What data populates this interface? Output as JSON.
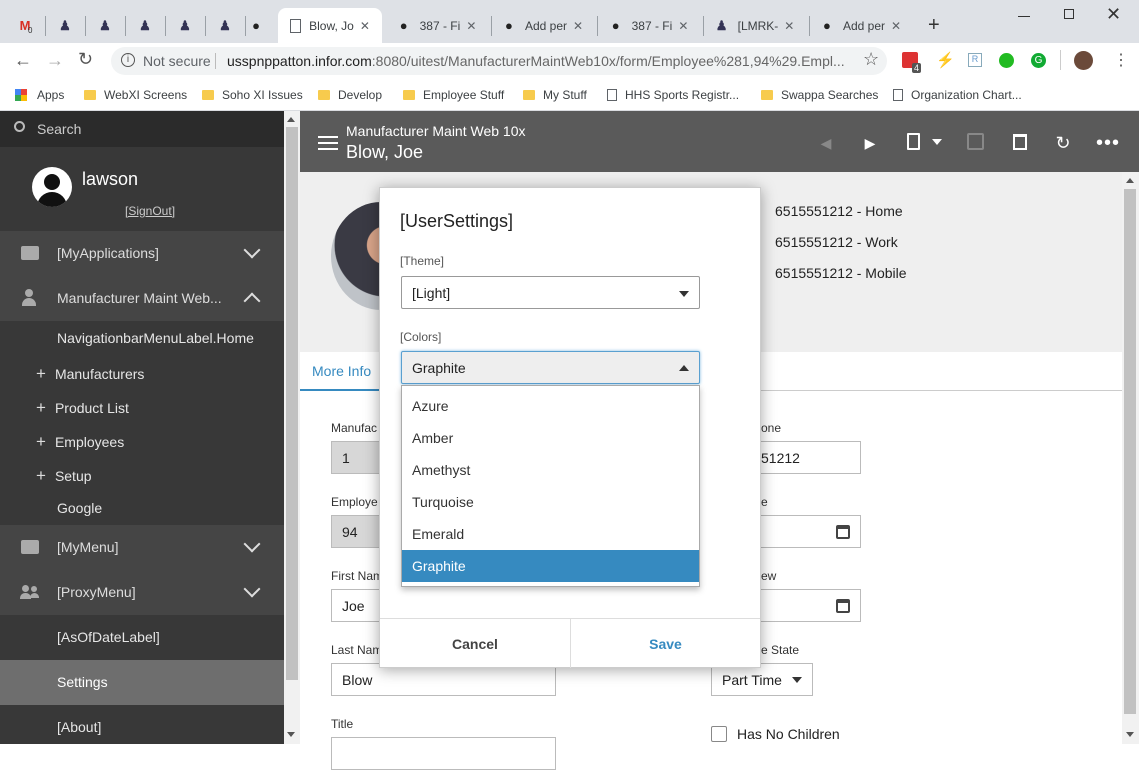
{
  "browser": {
    "tabs": [
      {
        "title": "",
        "icon": "gmail-icon",
        "badge": "0"
      },
      {
        "title": "",
        "icon": "jenkins-icon"
      },
      {
        "title": "",
        "icon": "jenkins-icon"
      },
      {
        "title": "",
        "icon": "jenkins-icon"
      },
      {
        "title": "",
        "icon": "jenkins-icon"
      },
      {
        "title": "",
        "icon": "jenkins-icon"
      },
      {
        "title": "",
        "icon": "github-icon"
      },
      {
        "title": "Blow, Jo",
        "icon": "page-icon",
        "active": true
      },
      {
        "title": "387 - Fi",
        "icon": "github-icon"
      },
      {
        "title": "Add per",
        "icon": "github-icon"
      },
      {
        "title": "387 - Fi",
        "icon": "github-icon"
      },
      {
        "title": "[LMRK-",
        "icon": "jenkins-icon"
      },
      {
        "title": "Add per",
        "icon": "github-icon"
      }
    ],
    "security": "Not secure",
    "url_host": "usspnppatton.infor.com",
    "url_rest": ":8080/uitest/ManufacturerMaintWeb10x/form/Employee%281,94%29.Empl...",
    "extension_badge": "4",
    "bookmarks": [
      "Apps",
      "WebXI Screens",
      "Soho XI Issues",
      "Develop",
      "Employee Stuff",
      "My Stuff",
      "HHS Sports Registr...",
      "Swappa Searches",
      "Organization Chart..."
    ]
  },
  "sidebar": {
    "search_placeholder": "Search",
    "username": "lawson",
    "signout": "[SignOut]",
    "my_applications": "[MyApplications]",
    "app_name": "Manufacturer Maint Web...",
    "home": "NavigationbarMenuLabel.Home",
    "items": [
      "Manufacturers",
      "Product List",
      "Employees",
      "Setup"
    ],
    "google": "Google",
    "my_menu": "[MyMenu]",
    "proxy_menu": "[ProxyMenu]",
    "as_of_date": "[AsOfDateLabel]",
    "settings": "Settings",
    "about": "[About]"
  },
  "appbar": {
    "subtitle": "Manufacturer Maint Web 10x",
    "title": "Blow, Joe"
  },
  "employee": {
    "phones": [
      "6515551212 - Home",
      "6515551212 - Work",
      "6515551212 - Mobile"
    ],
    "tab": "More Info",
    "labels": {
      "manufacturer": "Manufac",
      "employee": "Employe",
      "first_name": "First Nam",
      "last_name": "Last Nam",
      "title": "Title",
      "phone": "one",
      "date1": "e",
      "date2": "ew",
      "state": "e State"
    },
    "values": {
      "manufacturer": "1",
      "employee": "94",
      "first_name": "Joe",
      "last_name": "Blow",
      "phone": "51212",
      "state": "Part Time"
    },
    "has_no_children": "Has No Children"
  },
  "modal": {
    "title": "[UserSettings]",
    "theme_label": "[Theme]",
    "theme_value": "[Light]",
    "colors_label": "[Colors]",
    "colors_value": "Graphite",
    "options": [
      "Azure",
      "Amber",
      "Amethyst",
      "Turquoise",
      "Emerald",
      "Graphite"
    ],
    "selected_option": "Graphite",
    "cancel": "Cancel",
    "save": "Save"
  },
  "colors": {
    "accent": "#368ac0",
    "sidebar_bg": "#383838",
    "appbar_bg": "#5a5a5a"
  }
}
